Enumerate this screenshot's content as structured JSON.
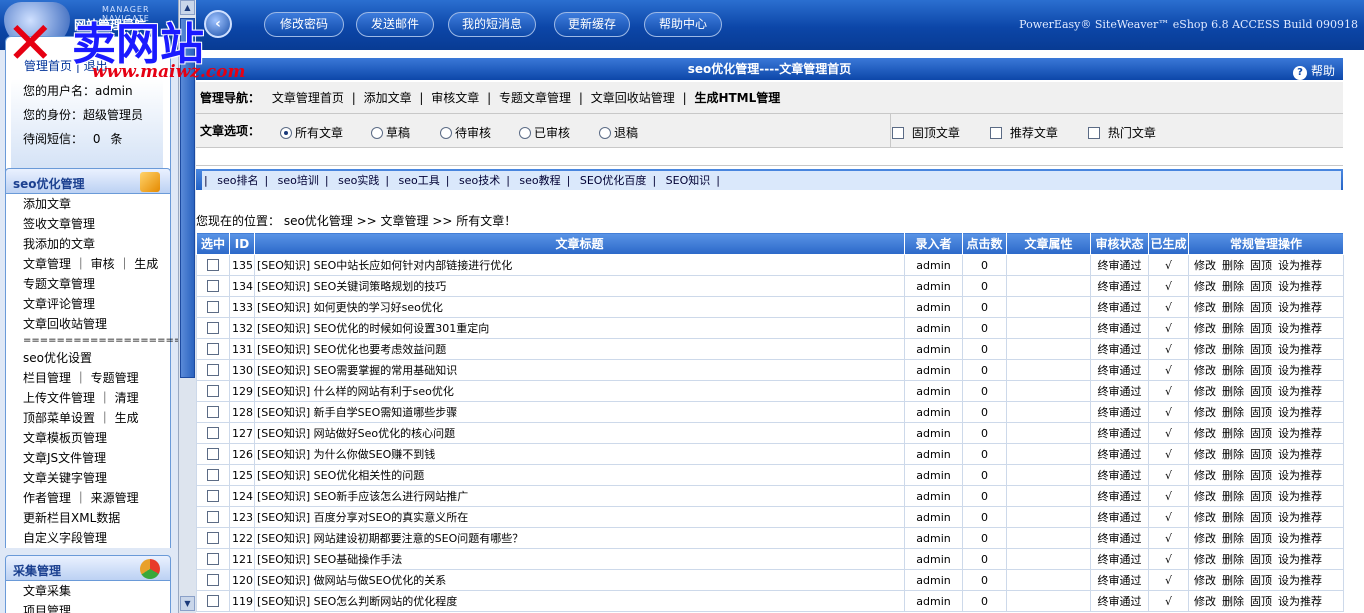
{
  "topbar": {
    "logo_small": "网站管理导航",
    "logo_managers": "MANAGER NAVIGATE",
    "watermark": "卖网站",
    "watermark_url": "www.maiwz.com",
    "buttons": [
      "修改密码",
      "发送邮件",
      "我的短消息",
      "更新缓存",
      "帮助中心"
    ],
    "brand": "PowerEasy® SiteWeaver™ eShop 6.8 ACCESS Build 090918"
  },
  "userbox": {
    "links": "管理首页 | 退出",
    "username_label": "您的用户名：admin",
    "role_label": "您的身份：超级管理员",
    "messages_label": "待阅短信：",
    "messages_count": "0",
    "messages_unit": "条"
  },
  "sidebar": {
    "section1": {
      "title": "seo优化管理",
      "items": [
        "添加文章",
        "签收文章管理",
        "我添加的文章",
        "文章管理 ｜ 审核 ｜ 生成",
        "专题文章管理",
        "文章评论管理",
        "文章回收站管理",
        "====================",
        "seo优化设置",
        "栏目管理 ｜ 专题管理",
        "上传文件管理 ｜ 清理",
        "顶部菜单设置 ｜ 生成",
        "文章模板页管理",
        "文章JS文件管理",
        "文章关键字管理",
        "作者管理 ｜ 来源管理",
        "更新栏目XML数据",
        "自定义字段管理"
      ]
    },
    "section2": {
      "title": "采集管理",
      "items": [
        "文章采集",
        "项目管理"
      ]
    }
  },
  "main": {
    "title": "seo优化管理----文章管理首页",
    "help": "帮助",
    "nav_label": "管理导航：",
    "nav_items": [
      "文章管理首页",
      "添加文章",
      "审核文章",
      "专题文章管理",
      "文章回收站管理",
      "生成HTML管理"
    ],
    "opt_label": "文章选项：",
    "radios": [
      "所有文章",
      "草稿",
      "待审核",
      "已审核",
      "退稿"
    ],
    "checks": [
      "固顶文章",
      "推荐文章",
      "热门文章"
    ],
    "categories": [
      "seo排名",
      "seo培训",
      "seo实践",
      "seo工具",
      "seo技术",
      "seo教程",
      "SEO优化百度",
      "SEO知识"
    ],
    "crumb": "您现在的位置：  seo优化管理 >> 文章管理 >> 所有文章！"
  },
  "table": {
    "headers": [
      "选中",
      "ID",
      "文章标题",
      "录入者",
      "点击数",
      "文章属性",
      "审核状态",
      "已生成",
      "常规管理操作"
    ],
    "actions": "修改 删除 固顶 设为推荐",
    "rows": [
      {
        "id": "135",
        "title": "[SEO知识] SEO中站长应如何针对内部链接进行优化",
        "author": "admin",
        "hits": "0",
        "status": "终审通过",
        "gen": "√"
      },
      {
        "id": "134",
        "title": "[SEO知识] SEO关键词策略规划的技巧",
        "author": "admin",
        "hits": "0",
        "status": "终审通过",
        "gen": "√"
      },
      {
        "id": "133",
        "title": "[SEO知识] 如何更快的学习好seo优化",
        "author": "admin",
        "hits": "0",
        "status": "终审通过",
        "gen": "√"
      },
      {
        "id": "132",
        "title": "[SEO知识] SEO优化的时候如何设置301重定向",
        "author": "admin",
        "hits": "0",
        "status": "终审通过",
        "gen": "√"
      },
      {
        "id": "131",
        "title": "[SEO知识] SEO优化也要考虑效益问题",
        "author": "admin",
        "hits": "0",
        "status": "终审通过",
        "gen": "√"
      },
      {
        "id": "130",
        "title": "[SEO知识] SEO需要掌握的常用基础知识",
        "author": "admin",
        "hits": "0",
        "status": "终审通过",
        "gen": "√"
      },
      {
        "id": "129",
        "title": "[SEO知识] 什么样的网站有利于seo优化",
        "author": "admin",
        "hits": "0",
        "status": "终审通过",
        "gen": "√"
      },
      {
        "id": "128",
        "title": "[SEO知识] 新手自学SEO需知道哪些步骤",
        "author": "admin",
        "hits": "0",
        "status": "终审通过",
        "gen": "√"
      },
      {
        "id": "127",
        "title": "[SEO知识] 网站做好Seo优化的核心问题",
        "author": "admin",
        "hits": "0",
        "status": "终审通过",
        "gen": "√"
      },
      {
        "id": "126",
        "title": "[SEO知识] 为什么你做SEO赚不到钱",
        "author": "admin",
        "hits": "0",
        "status": "终审通过",
        "gen": "√"
      },
      {
        "id": "125",
        "title": "[SEO知识] SEO优化相关性的问题",
        "author": "admin",
        "hits": "0",
        "status": "终审通过",
        "gen": "√"
      },
      {
        "id": "124",
        "title": "[SEO知识] SEO新手应该怎么进行网站推广",
        "author": "admin",
        "hits": "0",
        "status": "终审通过",
        "gen": "√"
      },
      {
        "id": "123",
        "title": "[SEO知识] 百度分享对SEO的真实意义所在",
        "author": "admin",
        "hits": "0",
        "status": "终审通过",
        "gen": "√"
      },
      {
        "id": "122",
        "title": "[SEO知识] 网站建设初期都要注意的SEO问题有哪些？",
        "author": "admin",
        "hits": "0",
        "status": "终审通过",
        "gen": "√"
      },
      {
        "id": "121",
        "title": "[SEO知识] SEO基础操作手法",
        "author": "admin",
        "hits": "0",
        "status": "终审通过",
        "gen": "√"
      },
      {
        "id": "120",
        "title": "[SEO知识] 做网站与做SEO优化的关系",
        "author": "admin",
        "hits": "0",
        "status": "终审通过",
        "gen": "√"
      },
      {
        "id": "119",
        "title": "[SEO知识] SEO怎么判断网站的优化程度",
        "author": "admin",
        "hits": "0",
        "status": "终审通过",
        "gen": "√"
      }
    ]
  }
}
